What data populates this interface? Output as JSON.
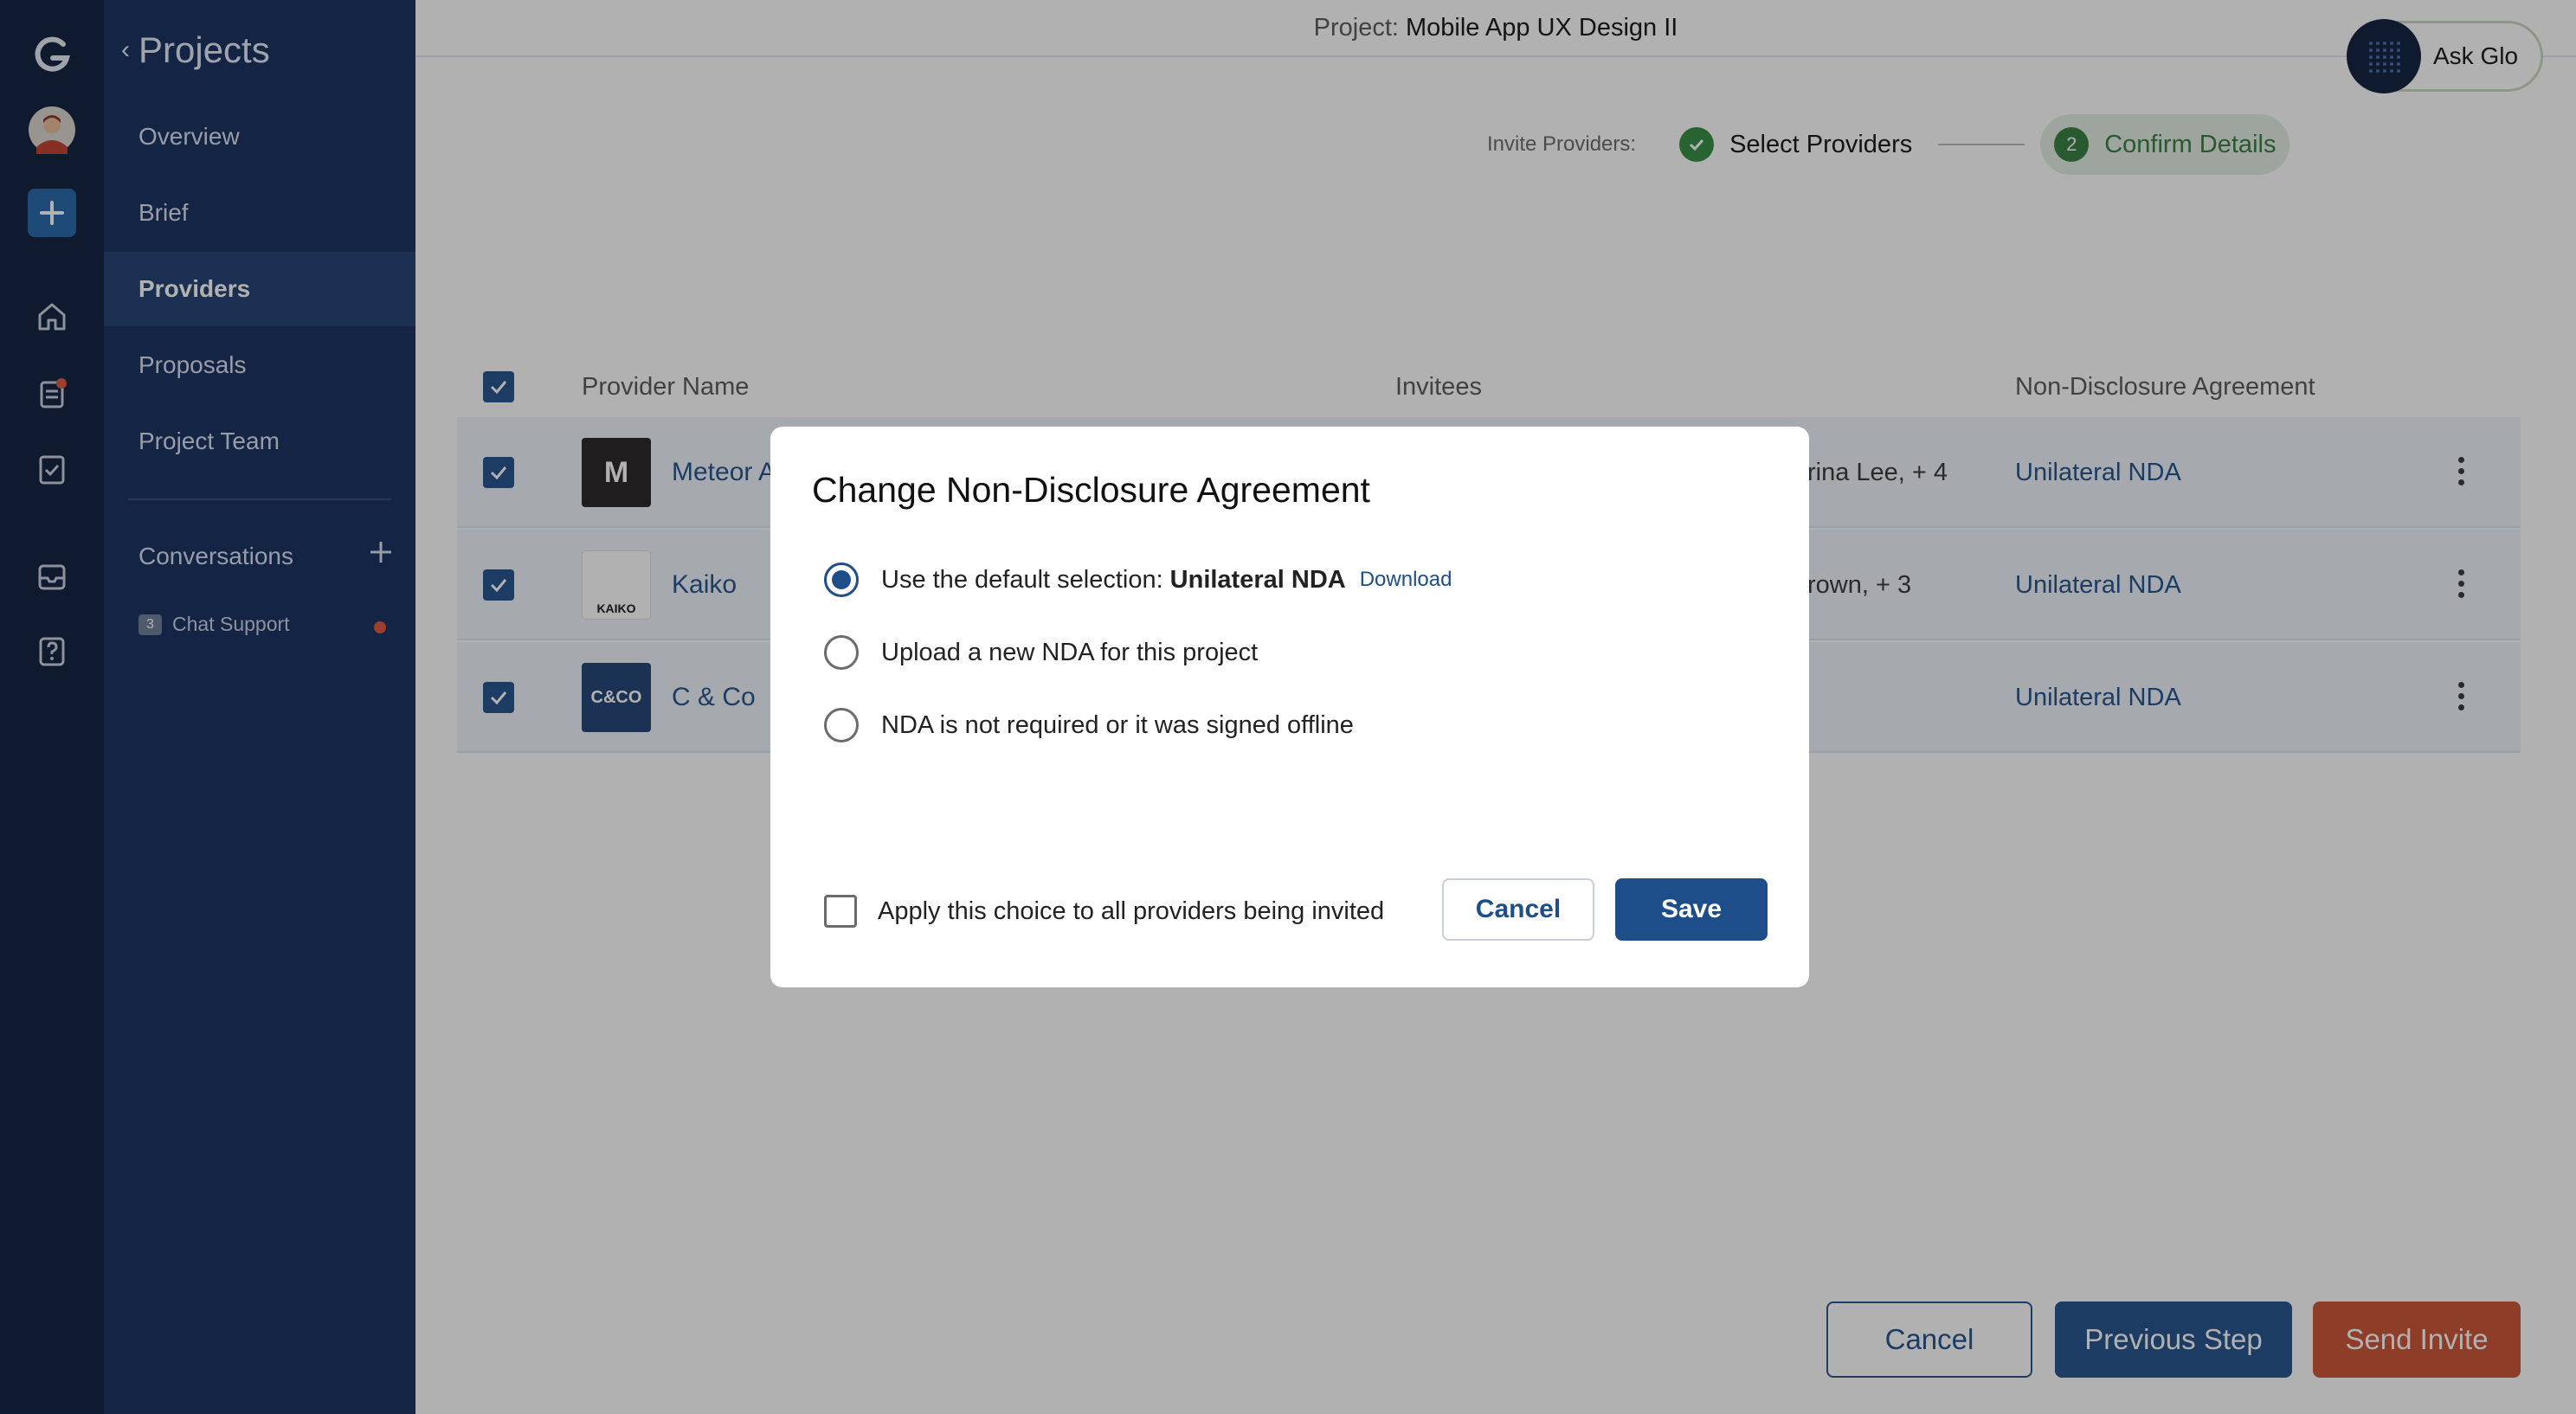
{
  "sidebar": {
    "back_label": "Projects",
    "items": [
      {
        "label": "Overview"
      },
      {
        "label": "Brief"
      },
      {
        "label": "Providers"
      },
      {
        "label": "Proposals"
      },
      {
        "label": "Project Team"
      }
    ],
    "conversations_label": "Conversations",
    "chat": {
      "badge": "3",
      "label": "Chat Support"
    }
  },
  "topbar": {
    "project_label": "Project:",
    "project_name": "Mobile App UX Design II",
    "ask_label": "Ask Glo"
  },
  "stepper": {
    "label": "Invite Providers:",
    "step1": "Select Providers",
    "step2_num": "2",
    "step2": "Confirm Details"
  },
  "table": {
    "headers": {
      "provider": "Provider Name",
      "invitees": "Invitees",
      "nda": "Non-Disclosure Agreement"
    },
    "rows": [
      {
        "logo_text": "M",
        "name": "Meteor A",
        "invitees": "rina Lee, + 4",
        "nda": "Unilateral NDA"
      },
      {
        "logo_text": "KAIKO",
        "name": "Kaiko",
        "invitees": "rown, + 3",
        "nda": "Unilateral NDA"
      },
      {
        "logo_text": "C&CO",
        "name": "C & Co",
        "invitees": "",
        "nda": "Unilateral NDA"
      }
    ]
  },
  "footer": {
    "cancel": "Cancel",
    "previous": "Previous Step",
    "send": "Send Invite"
  },
  "modal": {
    "title": "Change Non-Disclosure Agreement",
    "option1_prefix": "Use the default selection:",
    "option1_bold": "Unilateral NDA",
    "download": "Download",
    "option2": "Upload a new NDA for this project",
    "option3": "NDA is not required or it was signed offline",
    "apply_label": "Apply this choice to all providers being invited",
    "cancel": "Cancel",
    "save": "Save"
  },
  "colors": {
    "brand": "#1d4e89",
    "sidebar": "#12295a",
    "rail": "#0b1a3a",
    "send": "#c9502f",
    "success": "#2f7a3a"
  }
}
